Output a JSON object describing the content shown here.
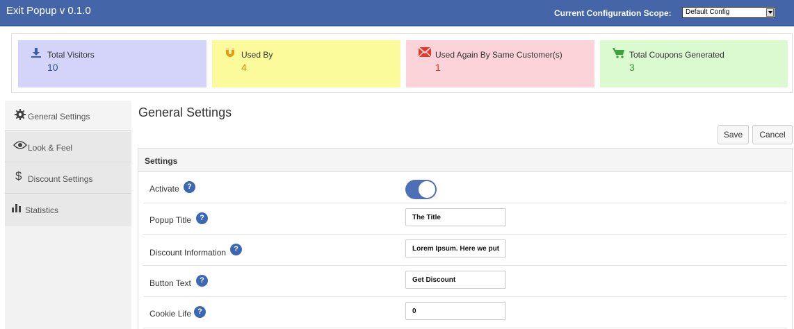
{
  "app": {
    "title": "Exit Popup  v 0.1.0"
  },
  "scope": {
    "label": "Current Configuration Scope:",
    "selected": "Default Config"
  },
  "stats": [
    {
      "label": "Total Visitors",
      "value": "10",
      "icon": "download-icon",
      "color": "#3a5fa8"
    },
    {
      "label": "Used By",
      "value": "4",
      "icon": "magnet-icon",
      "color": "#e39b12"
    },
    {
      "label": "Used Again By Same Customer(s)",
      "value": "1",
      "icon": "envelope-icon",
      "color": "#e03a2a"
    },
    {
      "label": "Total Coupons Generated",
      "value": "3",
      "icon": "cart-icon",
      "color": "#3aa33a"
    }
  ],
  "sidebar": {
    "items": [
      {
        "label": "General Settings",
        "icon": "gear-icon"
      },
      {
        "label": "Look & Feel",
        "icon": "eye-icon"
      },
      {
        "label": "Discount Settings",
        "icon": "dollar-icon"
      },
      {
        "label": "Statistics",
        "icon": "bar-chart-icon"
      }
    ]
  },
  "main": {
    "title": "General Settings",
    "save_label": "Save",
    "cancel_label": "Cancel",
    "panel_title": "Settings",
    "fields": {
      "activate": {
        "label": "Activate",
        "value": "on"
      },
      "popup_title": {
        "label": "Popup Title",
        "value": "The Title"
      },
      "discount_info": {
        "label": "Discount Information",
        "value": "Lorem Ipsum. Here we put t"
      },
      "button_text": {
        "label": "Button Text",
        "value": "Get Discount"
      },
      "cookie_life": {
        "label": "Cookie Life",
        "value": "0"
      }
    }
  }
}
